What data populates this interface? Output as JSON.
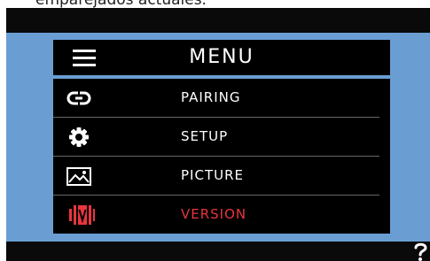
{
  "caption": "emparejados actuales.",
  "menu": {
    "title": "MENU",
    "items": [
      {
        "label": "PAIRING",
        "icon": "link-icon",
        "active": false
      },
      {
        "label": "SETUP",
        "icon": "gear-icon",
        "active": false
      },
      {
        "label": "PICTURE",
        "icon": "picture-icon",
        "active": false
      },
      {
        "label": "VERSION",
        "icon": "version-icon",
        "active": true
      }
    ]
  },
  "colors": {
    "screen_bg": "#6a9ed3",
    "menu_bg": "#000000",
    "active_text": "#e8353e",
    "bezel": "#0a0a0a"
  }
}
